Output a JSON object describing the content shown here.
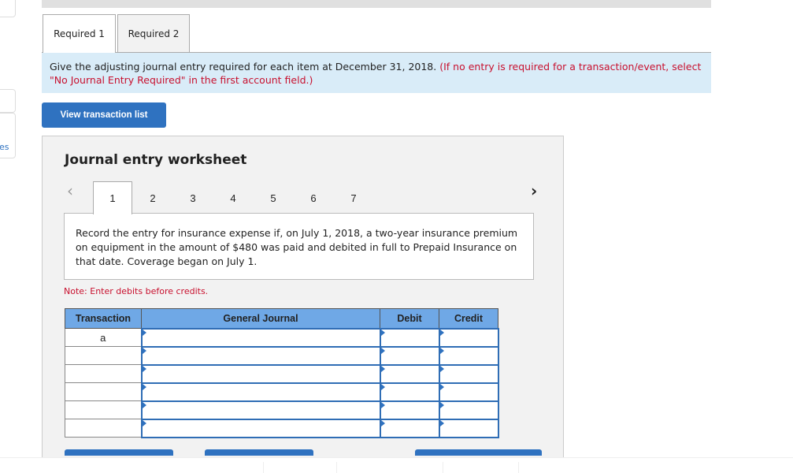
{
  "sidebar": {
    "link_fragment": "es"
  },
  "tabs": [
    {
      "label": "Required 1",
      "active": true
    },
    {
      "label": "Required 2",
      "active": false
    }
  ],
  "instructions": {
    "text": "Give the adjusting journal entry required for each item at December 31, 2018.",
    "note": "(If no entry is required for a transaction/event, select \"No Journal Entry Required\" in the first account field.)"
  },
  "view_button": "View transaction list",
  "worksheet": {
    "title": "Journal entry worksheet",
    "prev_icon": "chevron-left-icon",
    "next_icon": "chevron-right-icon",
    "prev": "‹",
    "next": "›",
    "steps": [
      "1",
      "2",
      "3",
      "4",
      "5",
      "6",
      "7"
    ],
    "active_step": "1",
    "description": "Record the entry for insurance expense if, on July 1, 2018, a two-year insurance premium on equipment in the amount of $480 was paid and debited in full to Prepaid Insurance on that date. Coverage began on July 1.",
    "note": "Note: Enter debits before credits.",
    "table": {
      "headers": [
        "Transaction",
        "General Journal",
        "Debit",
        "Credit"
      ],
      "rows": [
        {
          "transaction": "a",
          "account": "",
          "debit": "",
          "credit": ""
        },
        {
          "transaction": "",
          "account": "",
          "debit": "",
          "credit": ""
        },
        {
          "transaction": "",
          "account": "",
          "debit": "",
          "credit": ""
        },
        {
          "transaction": "",
          "account": "",
          "debit": "",
          "credit": ""
        },
        {
          "transaction": "",
          "account": "",
          "debit": "",
          "credit": ""
        },
        {
          "transaction": "",
          "account": "",
          "debit": "",
          "credit": ""
        }
      ]
    }
  },
  "colors": {
    "accent": "#2f72c0",
    "header": "#6fa8e6",
    "instruction_bg": "#d9ecf8",
    "warning": "#c8102e"
  }
}
